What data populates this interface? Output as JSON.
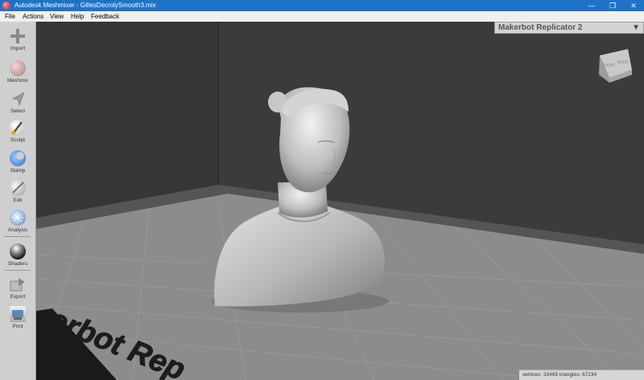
{
  "window": {
    "title": "Autodesk Meshmixer - GillesDecrolySmooth3.mix",
    "minimize": "—",
    "restore": "❐",
    "close": "✕"
  },
  "menu": [
    "File",
    "Actions",
    "View",
    "Help",
    "Feedback"
  ],
  "tools": [
    {
      "label": "Import",
      "icon": "plus-icon"
    },
    {
      "label": "Meshmix",
      "icon": "meshmix-icon"
    },
    {
      "label": "Select",
      "icon": "select-arrow-icon"
    },
    {
      "label": "Sculpt",
      "icon": "brush-icon"
    },
    {
      "label": "Stamp",
      "icon": "stamp-icon"
    },
    {
      "label": "Edit",
      "icon": "edit-icon"
    },
    {
      "label": "Analysis",
      "icon": "analysis-icon"
    },
    {
      "label": "Shaders",
      "icon": "shader-sphere-icon"
    },
    {
      "label": "Export",
      "icon": "export-icon"
    },
    {
      "label": "Print",
      "icon": "print-icon"
    }
  ],
  "printer": {
    "name": "Makerbot Replicator 2",
    "dropdown_icon": "triangle-down-icon"
  },
  "viewcube": {
    "faces": [
      "RIGHT",
      "BACK"
    ]
  },
  "platform_text": "erbot Rep",
  "status": "vertices: 33465 triangles: 67234"
}
